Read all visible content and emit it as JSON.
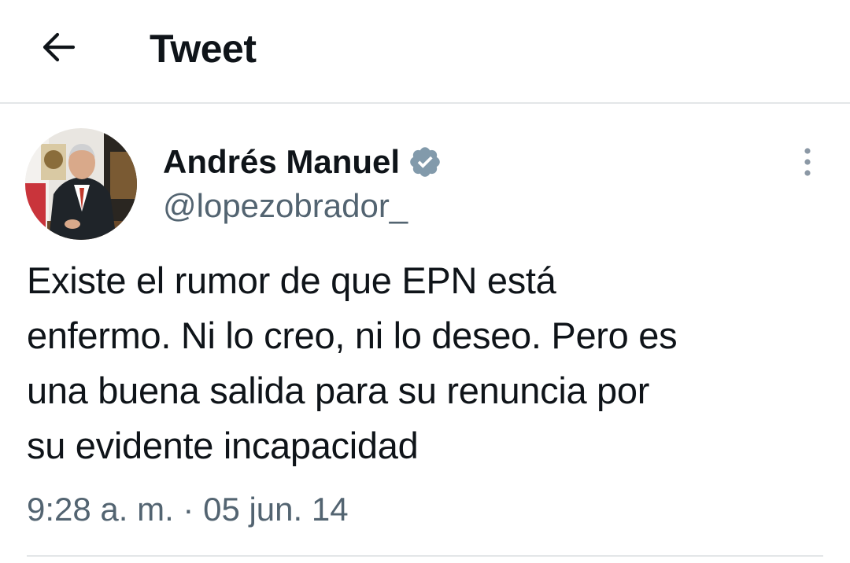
{
  "header": {
    "title": "Tweet",
    "back_icon": "arrow-left-icon"
  },
  "author": {
    "display_name": "Andrés Manuel",
    "handle": "@lopezobrador_",
    "verified": true,
    "verified_icon": "verified-badge-icon",
    "verified_color": "#829aab"
  },
  "tweet": {
    "lines": [
      "Existe el rumor de que EPN está",
      "enfermo. Ni lo creo, ni lo deseo. Pero es",
      "una buena salida para su renuncia por",
      "su evidente incapacidad"
    ],
    "timestamp": "9:28 a. m. · 05 jun. 14"
  },
  "actions": {
    "more_icon": "more-vertical-icon"
  },
  "colors": {
    "text_primary": "#0f1419",
    "text_secondary": "#536471",
    "divider": "#e3e6e8"
  }
}
